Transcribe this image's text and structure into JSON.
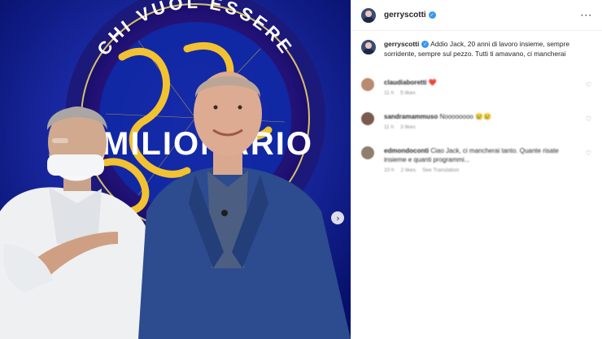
{
  "post": {
    "image": {
      "title_top": "CHI VUOL ESSERE",
      "title_main": "MILIONARIO",
      "colors": {
        "background": "#0a1a8c",
        "gold": "#f2c230",
        "ring": "#1b2a9a"
      }
    },
    "next_icon": "chevron-right-icon"
  },
  "header": {
    "username": "gerryscotti",
    "verified_icon": "verified-badge-icon",
    "more_icon": "more-options-icon",
    "more_glyph": "···"
  },
  "caption": {
    "username": "gerryscotti",
    "text": "Addio Jack, 20 anni di lavoro insieme, sempre sorridente, sempre sul pezzo. Tutti ti amavano, ci mancherai"
  },
  "comments": [
    {
      "username": "claudiaboretti",
      "text": "❤️",
      "meta": [
        "11 h",
        "5 likes"
      ],
      "avatar_color": "#b98a6f"
    },
    {
      "username": "sandramammuso",
      "text": "Noooooooo 😢😢",
      "meta": [
        "11 h",
        "3 likes"
      ],
      "avatar_color": "#7a5a4f"
    },
    {
      "username": "edmondoconti",
      "text": "Ciao Jack, ci mancherai tanto. Quante risate insieme e quanti programmi...",
      "meta": [
        "10 h",
        "2 likes",
        "See Translation"
      ],
      "avatar_color": "#8f7e6e"
    }
  ],
  "heart_glyph": "♡"
}
